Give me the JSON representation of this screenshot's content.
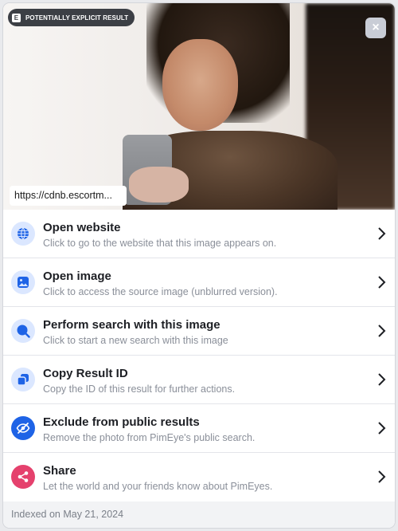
{
  "badge": {
    "letter": "E",
    "label": "POTENTIALLY EXPLICIT RESULT"
  },
  "close": {
    "glyph": "×"
  },
  "preview": {
    "url": "https://cdnb.escortm..."
  },
  "menu": {
    "items": [
      {
        "title": "Open website",
        "subtitle": "Click to go to the website that this image appears on.",
        "icon": "globe-icon",
        "icon_bg": "#dbe7ff",
        "icon_fg": "#1e63e6"
      },
      {
        "title": "Open image",
        "subtitle": "Click to access the source image (unblurred version).",
        "icon": "image-icon",
        "icon_bg": "#dbe7ff",
        "icon_fg": "#1e63e6"
      },
      {
        "title": "Perform search with this image",
        "subtitle": "Click to start a new search with this image",
        "icon": "search-icon",
        "icon_bg": "#dbe7ff",
        "icon_fg": "#1e63e6"
      },
      {
        "title": "Copy Result ID",
        "subtitle": "Copy the ID of this result for further actions.",
        "icon": "copy-icon",
        "icon_bg": "#dbe7ff",
        "icon_fg": "#1e63e6"
      },
      {
        "title": "Exclude from public results",
        "subtitle": "Remove the photo from PimEye's public search.",
        "icon": "eye-off-icon",
        "icon_bg": "#1e63e6",
        "icon_fg": "#ffffff"
      },
      {
        "title": "Share",
        "subtitle": "Let the world and your friends know about PimEyes.",
        "icon": "share-icon",
        "icon_bg": "#e5416d",
        "icon_fg": "#ffffff"
      }
    ]
  },
  "footer": {
    "indexed": "Indexed on May 21, 2024"
  }
}
